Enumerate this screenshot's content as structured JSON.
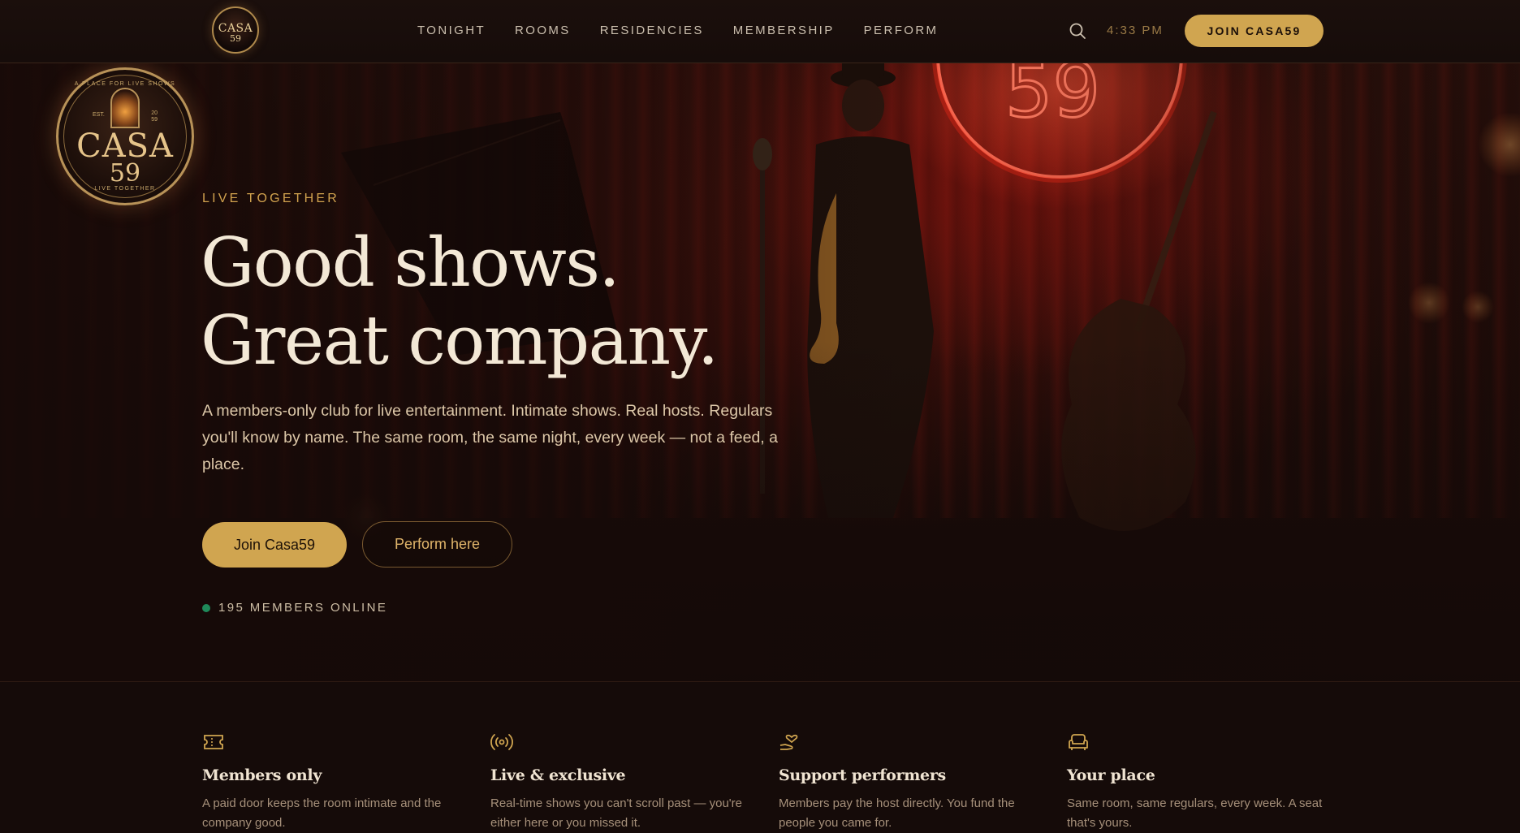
{
  "nav": {
    "logo": {
      "line1": "CASA",
      "line2": "59"
    },
    "links": [
      "TONIGHT",
      "ROOMS",
      "RESIDENCIES",
      "MEMBERSHIP",
      "PERFORM"
    ],
    "time": "4:33 PM",
    "join_label": "JOIN CASA59",
    "icons": {
      "search": "search-icon"
    }
  },
  "hero": {
    "badge": {
      "top_text": "A PLACE FOR LIVE SHOWS",
      "est": "EST.",
      "year_top": "20",
      "year_bottom": "59",
      "name": "CASA",
      "number": "59",
      "bottom_text": "LIVE TOGETHER"
    },
    "eyebrow": "LIVE TOGETHER",
    "headline_line1": "Good shows.",
    "headline_line2": "Great company.",
    "subtext": "A members-only club for live entertainment. Intimate shows. Real hosts. Regulars you'll know by name. The same room, the same night, every week — not a feed, a place.",
    "primary_cta": "Join Casa59",
    "secondary_cta": "Perform here",
    "online_text": "195 MEMBERS ONLINE",
    "neon_sign": "59"
  },
  "features": [
    {
      "icon": "ticket-icon",
      "title": "Members only",
      "text": "A paid door keeps the room intimate and the company good."
    },
    {
      "icon": "broadcast-icon",
      "title": "Live & exclusive",
      "text": "Real-time shows you can't scroll past — you're either here or you missed it."
    },
    {
      "icon": "hand-heart-icon",
      "title": "Support performers",
      "text": "Members pay the host directly. You fund the people you came for."
    },
    {
      "icon": "armchair-icon",
      "title": "Your place",
      "text": "Same room, same regulars, every week. A seat that's yours."
    }
  ],
  "colors": {
    "accent": "#d0a550",
    "background": "#140a08",
    "online": "#1f8a5a"
  }
}
